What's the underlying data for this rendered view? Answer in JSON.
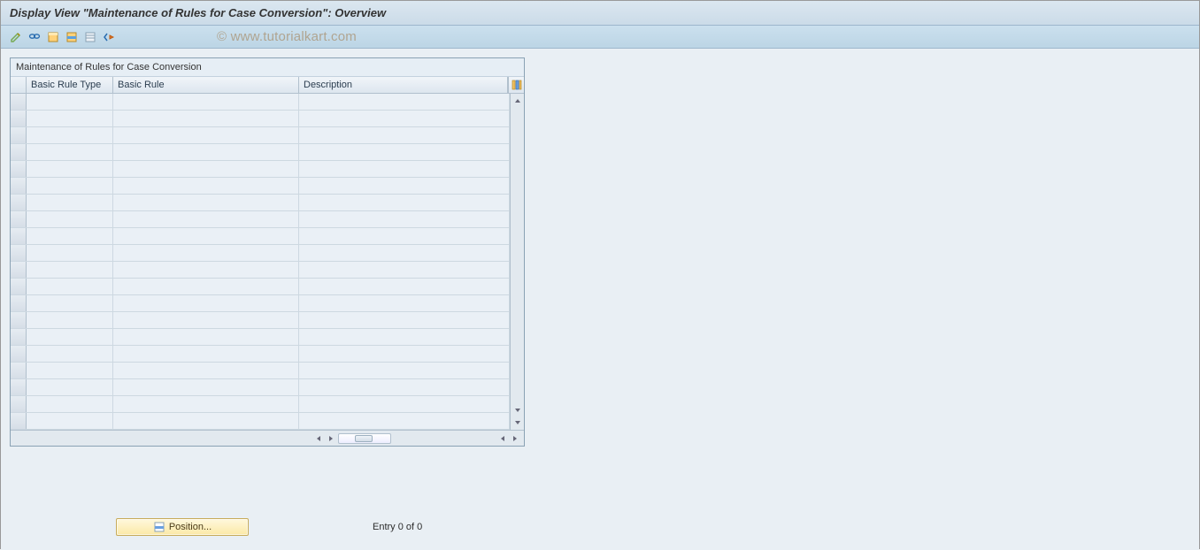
{
  "header": {
    "title": "Display View \"Maintenance of Rules for Case Conversion\": Overview"
  },
  "toolbar": {
    "icons": [
      {
        "name": "change-icon"
      },
      {
        "name": "glasses-icon"
      },
      {
        "name": "select-all-icon"
      },
      {
        "name": "select-block-icon"
      },
      {
        "name": "deselect-all-icon"
      },
      {
        "name": "navigate-icon"
      }
    ]
  },
  "watermark": "© www.tutorialkart.com",
  "table": {
    "title": "Maintenance of Rules for Case Conversion",
    "columns": {
      "type": "Basic Rule Type",
      "rule": "Basic Rule",
      "desc": "Description"
    },
    "config_icon": "configure-columns-icon",
    "row_count": 20
  },
  "footer": {
    "position_label": "Position...",
    "entry_text": "Entry 0 of 0"
  }
}
